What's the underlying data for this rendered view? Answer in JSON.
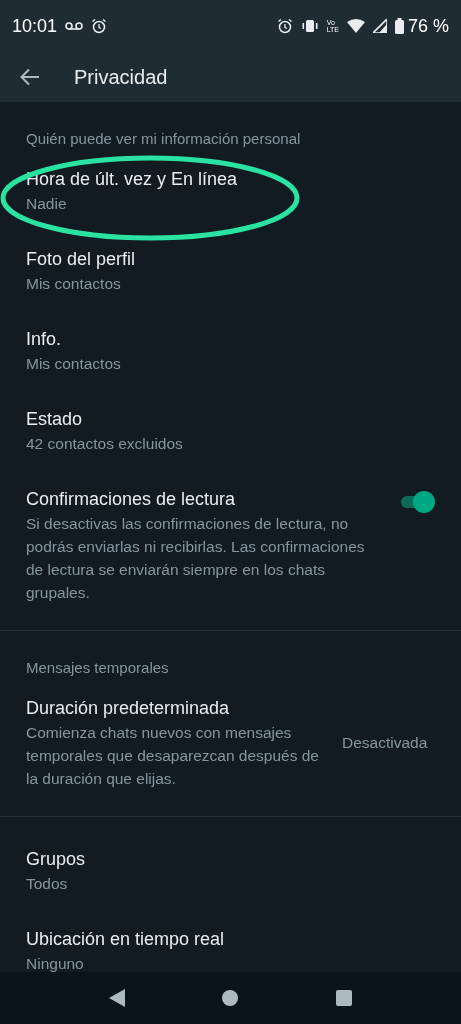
{
  "status_bar": {
    "time": "10:01",
    "volte": [
      "Vo",
      "LTE"
    ],
    "battery_text": "76 %"
  },
  "app_bar": {
    "title": "Privacidad"
  },
  "sections": [
    {
      "header": "Quién puede ver mi información personal",
      "items": [
        {
          "kind": "item",
          "title": "Hora de últ. vez y En línea",
          "subtitle": "Nadie",
          "highlighted": true
        },
        {
          "kind": "item",
          "title": "Foto del perfil",
          "subtitle": "Mis contactos",
          "highlighted": false
        },
        {
          "kind": "item",
          "title": "Info.",
          "subtitle": "Mis contactos",
          "highlighted": false
        },
        {
          "kind": "item",
          "title": "Estado",
          "subtitle": "42 contactos excluidos",
          "highlighted": false
        },
        {
          "kind": "toggle",
          "title": "Confirmaciones de lectura",
          "subtitle": "Si desactivas las confirmaciones de lectura, no podrás enviarlas ni recibirlas. Las confirmaciones de lectura se enviarán siempre en los chats grupales.",
          "on": true
        }
      ]
    },
    {
      "header": "Mensajes temporales",
      "items": [
        {
          "kind": "value",
          "title": "Duración predeterminada",
          "subtitle": "Comienza chats nuevos con mensajes temporales que desaparezcan después de la duración que elijas.",
          "value": "Desactivada"
        }
      ]
    },
    {
      "items": [
        {
          "kind": "item",
          "title": "Grupos",
          "subtitle": "Todos",
          "highlighted": false
        },
        {
          "kind": "item",
          "title": "Ubicación en tiempo real",
          "subtitle": "Ninguno",
          "highlighted": false
        }
      ]
    }
  ]
}
